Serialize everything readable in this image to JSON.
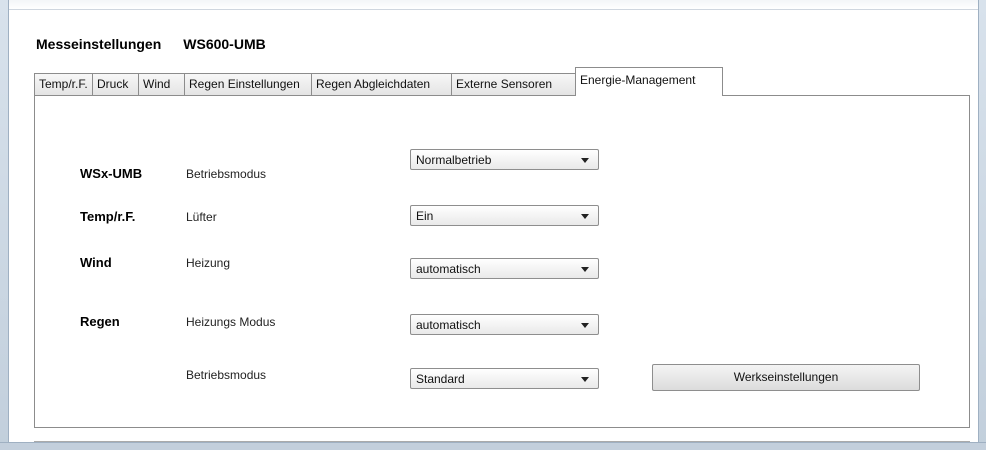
{
  "header": {
    "title": "Messeinstellungen",
    "device": "WS600-UMB"
  },
  "tabs": [
    {
      "label": "Temp/r.F."
    },
    {
      "label": "Druck"
    },
    {
      "label": "Wind"
    },
    {
      "label": "Regen Einstellungen"
    },
    {
      "label": "Regen Abgleichdaten"
    },
    {
      "label": "Externe Sensoren"
    },
    {
      "label": "Energie-Management"
    }
  ],
  "active_tab": "Energie-Management",
  "rows": [
    {
      "category": "WSx-UMB",
      "label": "Betriebsmodus",
      "value": "Normalbetrieb"
    },
    {
      "category": "Temp/r.F.",
      "label": "Lüfter",
      "value": "Ein"
    },
    {
      "category": "Wind",
      "label": "Heizung",
      "value": "automatisch"
    },
    {
      "category": "Regen",
      "label": "Heizungs Modus",
      "value": "automatisch"
    },
    {
      "category": "",
      "label": "Betriebsmodus",
      "value": "Standard"
    }
  ],
  "buttons": {
    "factory_reset": "Werkseinstellungen"
  }
}
